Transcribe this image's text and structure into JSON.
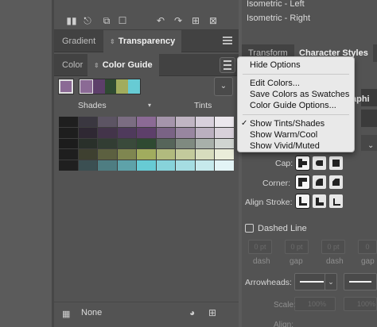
{
  "top_list": {
    "item_1": "Isometric - Left",
    "item_2": "Isometric - Right"
  },
  "left_panel": {
    "tab_gradient": "Gradient",
    "tab_transparency": "Transparency",
    "tab_color": "Color",
    "tab_color_guide": "Color Guide",
    "base_color": "#8b6a95",
    "harmony_colors": [
      "#8b6a95",
      "#5d3f6a",
      "#2f4a32",
      "#a1ac5e",
      "#67cbd4"
    ],
    "shades_label": "Shades",
    "tints_label": "Tints",
    "variations_grid": [
      [
        "#1f1f1f",
        "#3a3740",
        "#5c5463",
        "#7b6d82",
        "#8b6a95",
        "#a595ab",
        "#c0b5c3",
        "#d8d0dc",
        "#ece8ee"
      ],
      [
        "#1e1e1e",
        "#2f2833",
        "#43344a",
        "#4f3a5c",
        "#5d3f6a",
        "#7a6385",
        "#9886a0",
        "#bbb0c0",
        "#d8d1da"
      ],
      [
        "#1c1c1c",
        "#29302a",
        "#323d33",
        "#3a4a3b",
        "#2f4a32",
        "#56655a",
        "#7f8a80",
        "#a8b0aa",
        "#d0d5d1"
      ],
      [
        "#1e1e1e",
        "#3e4030",
        "#5c6040",
        "#7f8650",
        "#a1ac5e",
        "#b1ba7e",
        "#c3ca9c",
        "#d7dcbe",
        "#eaedda"
      ],
      [
        "#1f1f1f",
        "#3b4f52",
        "#4e7d82",
        "#5ea2a9",
        "#67cbd4",
        "#87d3da",
        "#a5dde2",
        "#c6e9ec",
        "#e3f4f6"
      ]
    ],
    "footer_label": "None"
  },
  "right_panel": {
    "tab_transform": "Transform",
    "tab_character_styles": "Character Styles",
    "partial_text": "aphi",
    "cap_label": "Cap:",
    "corner_label": "Corner:",
    "align_stroke_label": "Align Stroke:",
    "dashed_line_label": "Dashed Line",
    "dash_fields": [
      "0 pt",
      "0 pt",
      "0 pt",
      "0 pt",
      "0 pt",
      "0"
    ],
    "dash_captions": [
      "dash",
      "gap",
      "dash",
      "gap"
    ],
    "arrowheads_label": "Arrowheads:",
    "scale_label": "Scale:",
    "scale_values": [
      "100%",
      "100%"
    ],
    "align_label": "Align:"
  },
  "flyout_menu": {
    "hide_options": "Hide Options",
    "edit_colors": "Edit Colors...",
    "save_colors": "Save Colors as Swatches",
    "options": "Color Guide Options...",
    "show_tints_shades": "Show Tints/Shades",
    "show_warm_cool": "Show Warm/Cool",
    "show_vivid_muted": "Show Vivid/Muted",
    "checked_item": "Show Tints/Shades"
  }
}
